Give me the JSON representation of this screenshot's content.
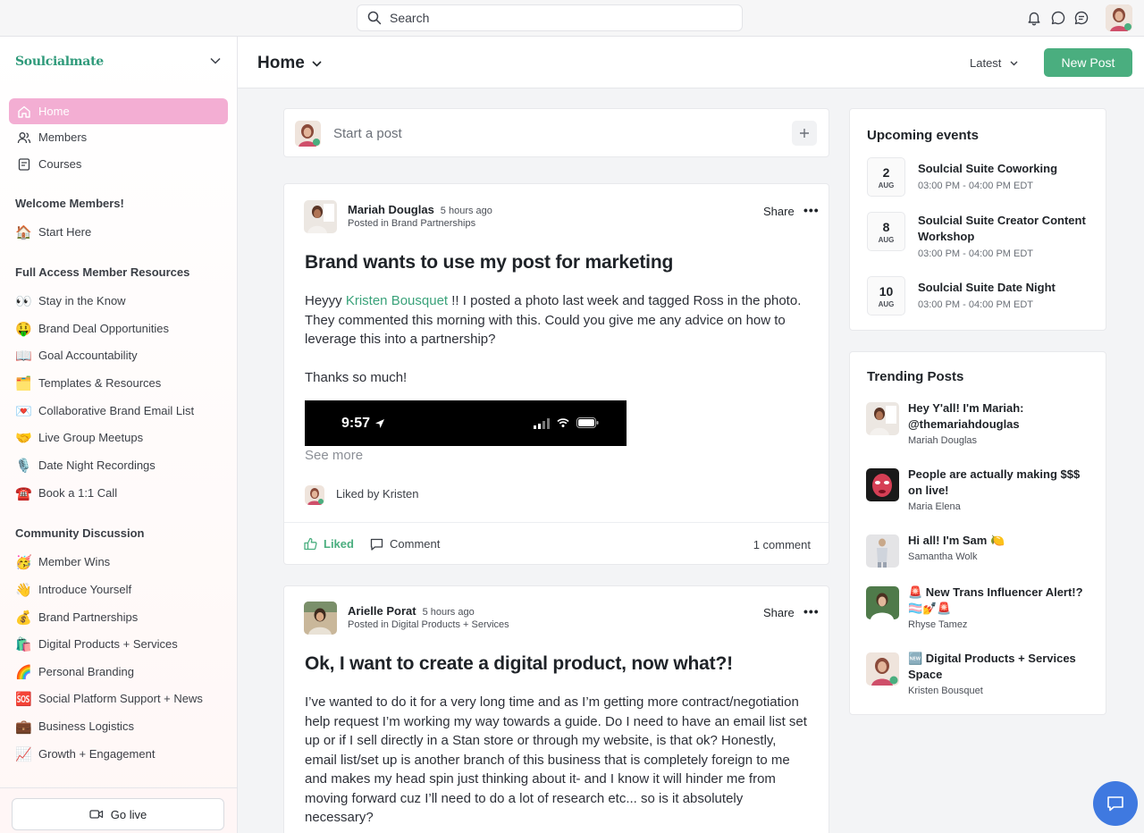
{
  "topbar": {
    "search_placeholder": "Search"
  },
  "sidebar": {
    "brand": "Soulcialmate",
    "nav": [
      {
        "label": "Home",
        "active": true
      },
      {
        "label": "Members"
      },
      {
        "label": "Courses"
      }
    ],
    "sections": [
      {
        "heading": "Welcome Members!",
        "items": [
          {
            "emoji": "🏠",
            "label": "Start Here"
          }
        ]
      },
      {
        "heading": "Full Access Member Resources",
        "items": [
          {
            "emoji": "👀",
            "label": "Stay in the Know"
          },
          {
            "emoji": "🤑",
            "label": "Brand Deal Opportunities"
          },
          {
            "emoji": "📖",
            "label": "Goal Accountability"
          },
          {
            "emoji": "🗂️",
            "label": "Templates & Resources"
          },
          {
            "emoji": "💌",
            "label": "Collaborative Brand Email List"
          },
          {
            "emoji": "🤝",
            "label": "Live Group Meetups"
          },
          {
            "emoji": "🎙️",
            "label": "Date Night Recordings"
          },
          {
            "emoji": "☎️",
            "label": "Book a 1:1 Call"
          }
        ]
      },
      {
        "heading": "Community Discussion",
        "items": [
          {
            "emoji": "🥳",
            "label": "Member Wins"
          },
          {
            "emoji": "👋",
            "label": "Introduce Yourself"
          },
          {
            "emoji": "💰",
            "label": "Brand Partnerships"
          },
          {
            "emoji": "🛍️",
            "label": "Digital Products + Services"
          },
          {
            "emoji": "🌈",
            "label": "Personal Branding"
          },
          {
            "emoji": "🆘",
            "label": "Social Platform Support + News"
          },
          {
            "emoji": "💼",
            "label": "Business Logistics"
          },
          {
            "emoji": "📈",
            "label": "Growth + Engagement"
          }
        ]
      }
    ],
    "go_live": "Go live"
  },
  "main": {
    "title": "Home",
    "sort": "Latest",
    "new_post": "New Post",
    "start_post": "Start a post"
  },
  "posts": [
    {
      "author": "Mariah Douglas",
      "time": "5 hours ago",
      "category": "Posted in Brand Partnerships",
      "share": "Share",
      "title": "Brand wants to use my post for marketing",
      "body_pre": "Heyyy ",
      "mention": "Kristen Bousquet",
      "body_post": " !! I posted a photo last week and tagged Ross in the photo. They commented this morning with this. Could you give me any advice on how to leverage this into a partnership?",
      "body2": "Thanks so much!",
      "phone_time": "9:57",
      "see_more": "See more",
      "liked_by": "Liked by Kristen",
      "liked_label": "Liked",
      "comment_label": "Comment",
      "comment_count": "1 comment"
    },
    {
      "author": "Arielle Porat",
      "time": "5 hours ago",
      "category": "Posted in Digital Products + Services",
      "share": "Share",
      "title": "Ok, I want to create a digital product, now what?!",
      "body": "I’ve wanted to do it for a very long time and as I’m getting more contract/negotiation help request I’m working my way towards a guide. Do I need to have an email list set up or if I sell directly in a Stan store or through my website, is that ok? Honestly, email list/set up is another branch of this business that is completely foreign to me and makes my head spin just thinking about it- and I know it will hinder me from moving forward cuz I’ll need to do a lot of research etc... so is it absolutely necessary?"
    }
  ],
  "events": {
    "heading": "Upcoming events",
    "items": [
      {
        "day": "2",
        "month": "AUG",
        "title": "Soulcial Suite Coworking",
        "time": "03:00 PM - 04:00 PM EDT"
      },
      {
        "day": "8",
        "month": "AUG",
        "title": "Soulcial Suite Creator Content Workshop",
        "time": "03:00 PM - 04:00 PM EDT"
      },
      {
        "day": "10",
        "month": "AUG",
        "title": "Soulcial Suite Date Night",
        "time": "03:00 PM - 04:00 PM EDT"
      }
    ]
  },
  "trending": {
    "heading": "Trending Posts",
    "items": [
      {
        "title": "Hey Y'all! I'm Mariah: @themariahdouglas",
        "author": "Mariah Douglas"
      },
      {
        "title": "People are actually making $$$ on live!",
        "author": "Maria Elena"
      },
      {
        "title": "Hi all! I'm Sam 🍋",
        "author": "Samantha Wolk"
      },
      {
        "title": "🚨 New Trans Influencer Alert!? 🏳️‍⚧️💅🚨",
        "author": "Rhyse Tamez"
      },
      {
        "title": "🆕 Digital Products + Services Space",
        "author": "Kristen Bousquet"
      }
    ]
  },
  "colors": {
    "accent": "#4aae7f",
    "nav_active": "#f3aed3",
    "chat_fab": "#3f79e0"
  },
  "icons": [
    "search-icon",
    "bell-icon",
    "chat-bubble-icon",
    "messages-icon",
    "home-icon",
    "members-icon",
    "courses-icon",
    "chevron-down-icon",
    "plus-icon",
    "more-icon",
    "thumbs-up-icon",
    "comment-icon",
    "video-camera-icon"
  ]
}
